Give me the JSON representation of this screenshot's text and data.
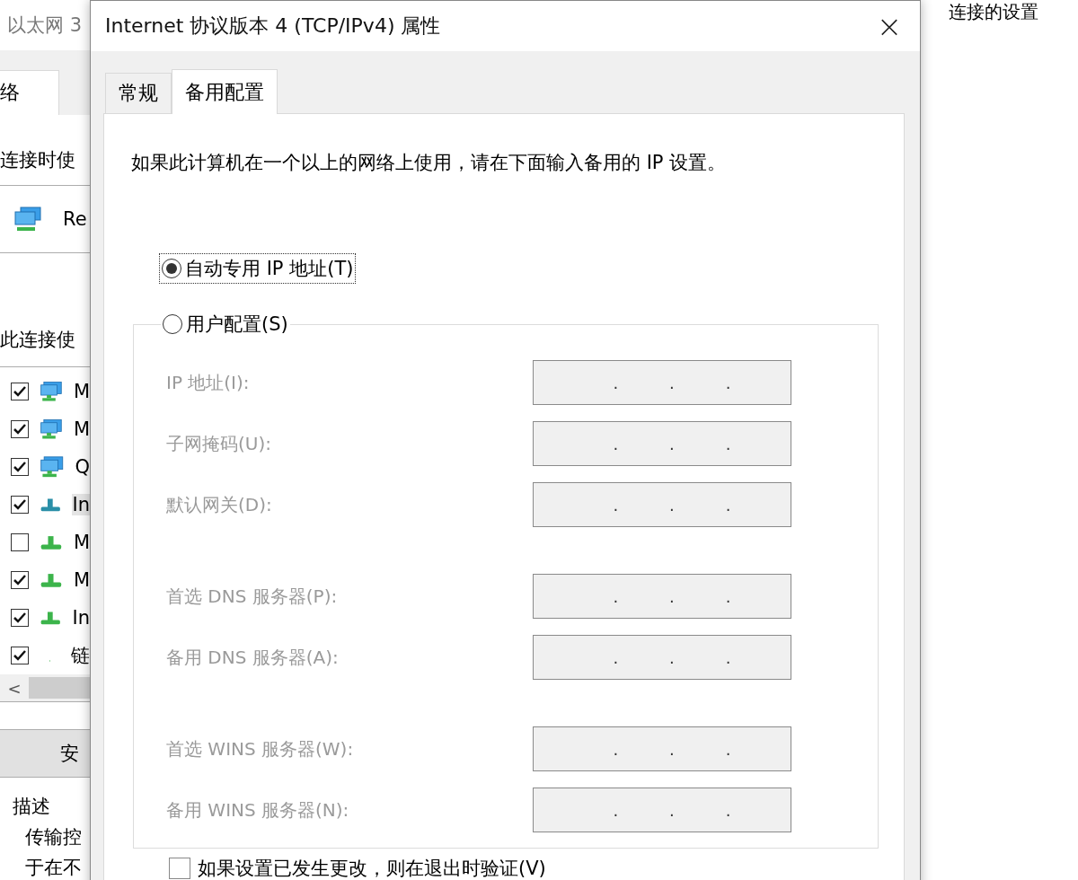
{
  "background_window": {
    "title": "以太网 3",
    "top_right_text": "连接的设置",
    "tab": {
      "label": "络",
      "selected": true
    },
    "connect_using_label": "连接时使",
    "adapter_name": "Re",
    "items_label": "此连接使",
    "items": [
      {
        "label": "M",
        "checked": true,
        "kind": "adapter",
        "selected": false
      },
      {
        "label": "M",
        "checked": true,
        "kind": "adapter",
        "selected": false
      },
      {
        "label": "Q",
        "checked": true,
        "kind": "adapter",
        "selected": false
      },
      {
        "label": "In",
        "checked": true,
        "kind": "protocol",
        "selected": true
      },
      {
        "label": "M",
        "checked": false,
        "kind": "protocol",
        "selected": false
      },
      {
        "label": "M",
        "checked": true,
        "kind": "protocol",
        "selected": false
      },
      {
        "label": "In",
        "checked": true,
        "kind": "protocol",
        "selected": false
      },
      {
        "label": "链",
        "checked": true,
        "kind": "small",
        "selected": false
      }
    ],
    "scroll_arrow": "<",
    "install_button": "安",
    "description_title": "描述",
    "description_lines": [
      "传输控",
      "于在不"
    ]
  },
  "dialog": {
    "title": "Internet 协议版本 4 (TCP/IPv4) 属性",
    "close": "×",
    "tabs": [
      {
        "label": "常规",
        "selected": false
      },
      {
        "label": "备用配置",
        "selected": true
      }
    ],
    "instruction": "如果此计算机在一个以上的网络上使用，请在下面输入备用的 IP 设置。",
    "options": [
      {
        "label": "自动专用 IP 地址(T)",
        "selected": true,
        "focused": true
      },
      {
        "label": "用户配置(S)",
        "selected": false,
        "focused": false
      }
    ],
    "field_groups": [
      [
        {
          "label": "IP 地址(I):",
          "disabled": true,
          "separators": [
            ".",
            ".",
            "."
          ]
        },
        {
          "label": "子网掩码(U):",
          "disabled": true,
          "separators": [
            ".",
            ".",
            "."
          ]
        },
        {
          "label": "默认网关(D):",
          "disabled": true,
          "separators": [
            ".",
            ".",
            "."
          ]
        }
      ],
      [
        {
          "label": "首选 DNS 服务器(P):",
          "disabled": true,
          "separators": [
            ".",
            ".",
            "."
          ]
        },
        {
          "label": "备用 DNS 服务器(A):",
          "disabled": true,
          "separators": [
            ".",
            ".",
            "."
          ]
        }
      ],
      [
        {
          "label": "首选 WINS 服务器(W):",
          "disabled": true,
          "separators": [
            ".",
            ".",
            "."
          ]
        },
        {
          "label": "备用 WINS 服务器(N):",
          "disabled": true,
          "separators": [
            ".",
            ".",
            "."
          ]
        }
      ]
    ],
    "validate": {
      "label": "如果设置已发生更改，则在退出时验证(V)",
      "checked": false
    }
  }
}
